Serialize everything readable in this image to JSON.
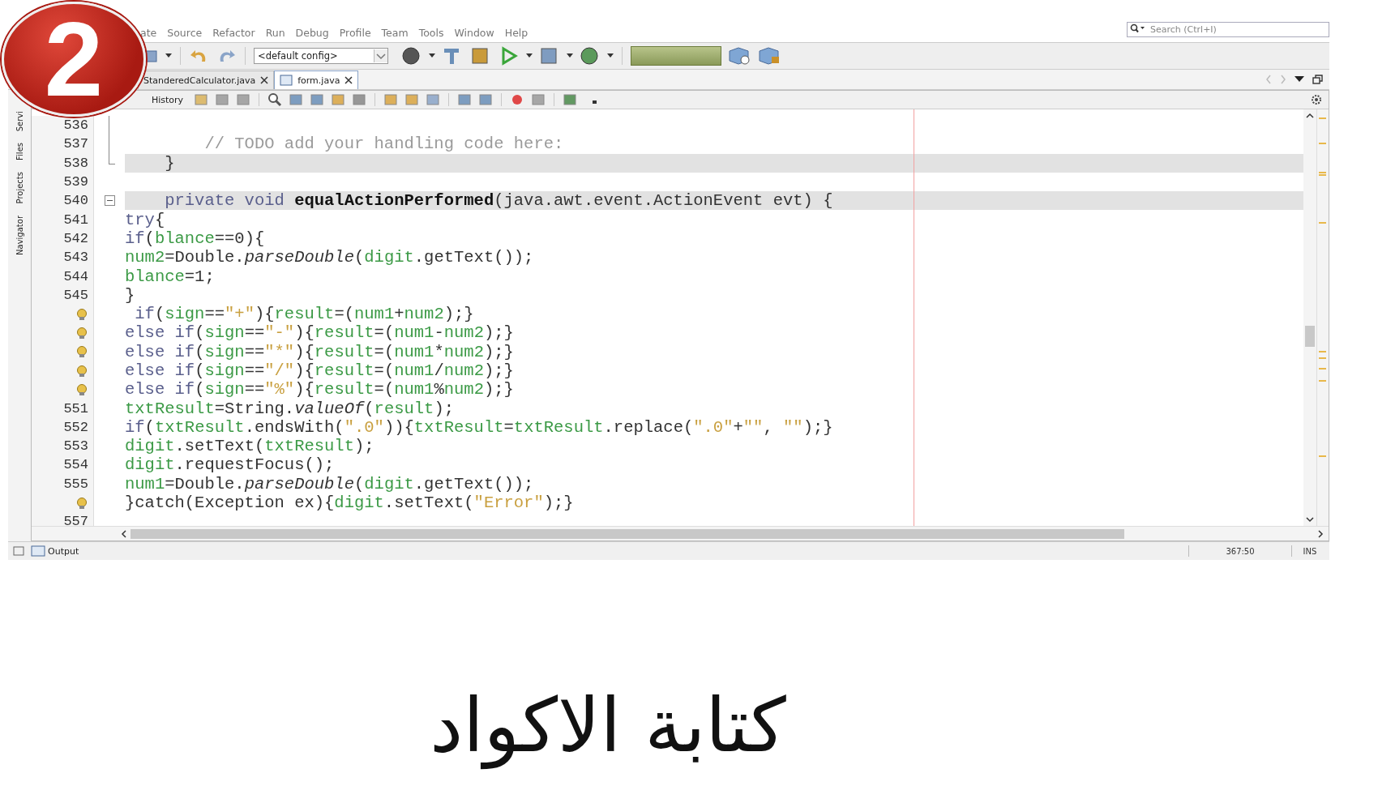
{
  "badge": "2",
  "menu": [
    "ate",
    "Source",
    "Refactor",
    "Run",
    "Debug",
    "Profile",
    "Team",
    "Tools",
    "Window",
    "Help"
  ],
  "search": {
    "placeholder": "Search (Ctrl+I)"
  },
  "toolbar": {
    "config": "<default config>"
  },
  "tabs": [
    {
      "label": "StanderedCalculator.java",
      "selected": false
    },
    {
      "label": "form.java",
      "selected": true
    }
  ],
  "editor_toolbar": {
    "history": "History"
  },
  "side_panels": [
    "Servi",
    "Files",
    "Projects",
    "Navigator"
  ],
  "code": [
    {
      "kind": "number",
      "number": "536",
      "highlighted": false,
      "fold": {
        "kind": "line"
      }
    },
    {
      "kind": "number",
      "number": "537",
      "highlighted": false,
      "fold": {
        "kind": "line"
      },
      "segments": [
        {
          "kind": "comment",
          "t": "        // TODO add your handling code here:"
        }
      ]
    },
    {
      "kind": "number",
      "number": "538",
      "highlighted": true,
      "fold": {
        "kind": "end"
      },
      "segments": [
        {
          "kind": "plain",
          "t": "    }"
        }
      ]
    },
    {
      "kind": "number",
      "number": "539",
      "highlighted": false
    },
    {
      "kind": "number",
      "number": "540",
      "highlighted": true,
      "fold": {
        "kind": "start"
      },
      "segments": [
        {
          "kind": "kw",
          "t": "    private void "
        },
        {
          "kind": "method",
          "t": "equalActionPerformed"
        },
        {
          "kind": "plain",
          "t": "(java.awt.event.ActionEvent evt) {"
        }
      ]
    },
    {
      "kind": "number",
      "number": "541",
      "highlighted": false,
      "segments": [
        {
          "kind": "kw",
          "t": "try"
        },
        {
          "kind": "plain",
          "t": "{"
        }
      ]
    },
    {
      "kind": "number",
      "number": "542",
      "highlighted": false,
      "segments": [
        {
          "kind": "kw",
          "t": "if"
        },
        {
          "kind": "plain",
          "t": "("
        },
        {
          "kind": "field",
          "t": "blance"
        },
        {
          "kind": "plain",
          "t": "==0){"
        }
      ]
    },
    {
      "kind": "number",
      "number": "543",
      "highlighted": false,
      "segments": [
        {
          "kind": "field",
          "t": "num2"
        },
        {
          "kind": "plain",
          "t": "=Double."
        },
        {
          "kind": "static",
          "t": "parseDouble"
        },
        {
          "kind": "plain",
          "t": "("
        },
        {
          "kind": "field",
          "t": "digit"
        },
        {
          "kind": "plain",
          "t": ".getText());"
        }
      ]
    },
    {
      "kind": "number",
      "number": "544",
      "highlighted": false,
      "segments": [
        {
          "kind": "field",
          "t": "blance"
        },
        {
          "kind": "plain",
          "t": "=1;"
        }
      ]
    },
    {
      "kind": "number",
      "number": "545",
      "highlighted": false,
      "segments": [
        {
          "kind": "plain",
          "t": "}"
        }
      ]
    },
    {
      "kind": "hint",
      "highlighted": false,
      "segments": [
        {
          "kind": "kw",
          "t": " if"
        },
        {
          "kind": "plain",
          "t": "("
        },
        {
          "kind": "field",
          "t": "sign"
        },
        {
          "kind": "plain",
          "t": "=="
        },
        {
          "kind": "str",
          "t": "\"+\""
        },
        {
          "kind": "plain",
          "t": "){"
        },
        {
          "kind": "field",
          "t": "result"
        },
        {
          "kind": "plain",
          "t": "=("
        },
        {
          "kind": "field",
          "t": "num1"
        },
        {
          "kind": "plain",
          "t": "+"
        },
        {
          "kind": "field",
          "t": "num2"
        },
        {
          "kind": "plain",
          "t": ");}"
        }
      ]
    },
    {
      "kind": "hint",
      "highlighted": false,
      "segments": [
        {
          "kind": "kw",
          "t": "else if"
        },
        {
          "kind": "plain",
          "t": "("
        },
        {
          "kind": "field",
          "t": "sign"
        },
        {
          "kind": "plain",
          "t": "=="
        },
        {
          "kind": "str",
          "t": "\"-\""
        },
        {
          "kind": "plain",
          "t": "){"
        },
        {
          "kind": "field",
          "t": "result"
        },
        {
          "kind": "plain",
          "t": "=("
        },
        {
          "kind": "field",
          "t": "num1"
        },
        {
          "kind": "plain",
          "t": "-"
        },
        {
          "kind": "field",
          "t": "num2"
        },
        {
          "kind": "plain",
          "t": ");}"
        }
      ]
    },
    {
      "kind": "hint",
      "highlighted": false,
      "segments": [
        {
          "kind": "kw",
          "t": "else if"
        },
        {
          "kind": "plain",
          "t": "("
        },
        {
          "kind": "field",
          "t": "sign"
        },
        {
          "kind": "plain",
          "t": "=="
        },
        {
          "kind": "str",
          "t": "\"*\""
        },
        {
          "kind": "plain",
          "t": "){"
        },
        {
          "kind": "field",
          "t": "result"
        },
        {
          "kind": "plain",
          "t": "=("
        },
        {
          "kind": "field",
          "t": "num1"
        },
        {
          "kind": "plain",
          "t": "*"
        },
        {
          "kind": "field",
          "t": "num2"
        },
        {
          "kind": "plain",
          "t": ");}"
        }
      ]
    },
    {
      "kind": "hint",
      "highlighted": false,
      "segments": [
        {
          "kind": "kw",
          "t": "else if"
        },
        {
          "kind": "plain",
          "t": "("
        },
        {
          "kind": "field",
          "t": "sign"
        },
        {
          "kind": "plain",
          "t": "=="
        },
        {
          "kind": "str",
          "t": "\"/\""
        },
        {
          "kind": "plain",
          "t": "){"
        },
        {
          "kind": "field",
          "t": "result"
        },
        {
          "kind": "plain",
          "t": "=("
        },
        {
          "kind": "field",
          "t": "num1"
        },
        {
          "kind": "plain",
          "t": "/"
        },
        {
          "kind": "field",
          "t": "num2"
        },
        {
          "kind": "plain",
          "t": ");}"
        }
      ]
    },
    {
      "kind": "hint",
      "highlighted": false,
      "segments": [
        {
          "kind": "kw",
          "t": "else if"
        },
        {
          "kind": "plain",
          "t": "("
        },
        {
          "kind": "field",
          "t": "sign"
        },
        {
          "kind": "plain",
          "t": "=="
        },
        {
          "kind": "str",
          "t": "\"%\""
        },
        {
          "kind": "plain",
          "t": "){"
        },
        {
          "kind": "field",
          "t": "result"
        },
        {
          "kind": "plain",
          "t": "=("
        },
        {
          "kind": "field",
          "t": "num1"
        },
        {
          "kind": "plain",
          "t": "%"
        },
        {
          "kind": "field",
          "t": "num2"
        },
        {
          "kind": "plain",
          "t": ");}"
        }
      ]
    },
    {
      "kind": "number",
      "number": "551",
      "highlighted": false,
      "segments": [
        {
          "kind": "field",
          "t": "txtResult"
        },
        {
          "kind": "plain",
          "t": "=String."
        },
        {
          "kind": "static",
          "t": "valueOf"
        },
        {
          "kind": "plain",
          "t": "("
        },
        {
          "kind": "field",
          "t": "result"
        },
        {
          "kind": "plain",
          "t": ");"
        }
      ]
    },
    {
      "kind": "number",
      "number": "552",
      "highlighted": false,
      "segments": [
        {
          "kind": "kw",
          "t": "if"
        },
        {
          "kind": "plain",
          "t": "("
        },
        {
          "kind": "field",
          "t": "txtResult"
        },
        {
          "kind": "plain",
          "t": ".endsWith("
        },
        {
          "kind": "str",
          "t": "\".0\""
        },
        {
          "kind": "plain",
          "t": ")){"
        },
        {
          "kind": "field",
          "t": "txtResult"
        },
        {
          "kind": "plain",
          "t": "="
        },
        {
          "kind": "field",
          "t": "txtResult"
        },
        {
          "kind": "plain",
          "t": ".replace("
        },
        {
          "kind": "str",
          "t": "\".0\""
        },
        {
          "kind": "plain",
          "t": "+"
        },
        {
          "kind": "str",
          "t": "\"\""
        },
        {
          "kind": "plain",
          "t": ", "
        },
        {
          "kind": "str",
          "t": "\"\""
        },
        {
          "kind": "plain",
          "t": ");}"
        }
      ]
    },
    {
      "kind": "number",
      "number": "553",
      "highlighted": false,
      "segments": [
        {
          "kind": "field",
          "t": "digit"
        },
        {
          "kind": "plain",
          "t": ".setText("
        },
        {
          "kind": "field",
          "t": "txtResult"
        },
        {
          "kind": "plain",
          "t": ");"
        }
      ]
    },
    {
      "kind": "number",
      "number": "554",
      "highlighted": false,
      "segments": [
        {
          "kind": "field",
          "t": "digit"
        },
        {
          "kind": "plain",
          "t": ".requestFocus();"
        }
      ]
    },
    {
      "kind": "number",
      "number": "555",
      "highlighted": false,
      "segments": [
        {
          "kind": "field",
          "t": "num1"
        },
        {
          "kind": "plain",
          "t": "=Double."
        },
        {
          "kind": "static",
          "t": "parseDouble"
        },
        {
          "kind": "plain",
          "t": "("
        },
        {
          "kind": "field",
          "t": "digit"
        },
        {
          "kind": "plain",
          "t": ".getText());"
        }
      ]
    },
    {
      "kind": "hint",
      "highlighted": false,
      "segments": [
        {
          "kind": "plain",
          "t": "}catch(Exception ex){"
        },
        {
          "kind": "field",
          "t": "digit"
        },
        {
          "kind": "plain",
          "t": ".setText("
        },
        {
          "kind": "str",
          "t": "\"Error\""
        },
        {
          "kind": "plain",
          "t": ");}"
        }
      ]
    },
    {
      "kind": "number",
      "number": "557",
      "highlighted": false
    }
  ],
  "status_bar": {
    "output": "Output",
    "position": "367:50",
    "mode": "INS"
  },
  "caption": "كتابة الاكواد"
}
